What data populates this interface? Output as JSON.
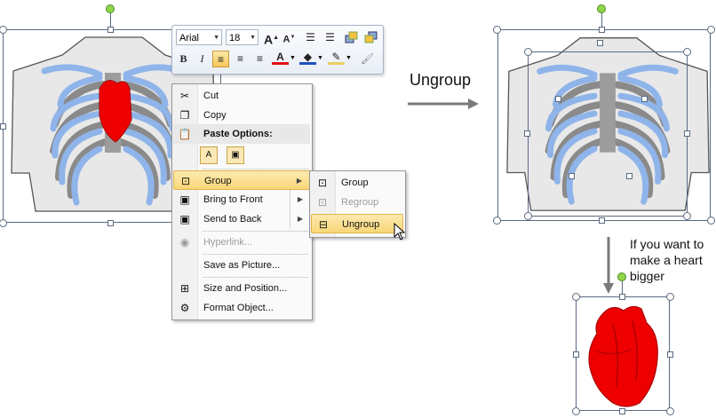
{
  "toolbar": {
    "font_name": "Arial",
    "font_size": "18",
    "buttons": [
      "grow-font",
      "shrink-font",
      "decrease-indent",
      "increase-indent",
      "bring-forward",
      "send-backward",
      "bold",
      "italic",
      "align-left",
      "center",
      "align-right",
      "font-color",
      "fill-color",
      "outline-color",
      "format-painter"
    ],
    "bold_label": "B",
    "italic_label": "I",
    "font_color_label": "A",
    "accent_highlight": "#f6c65c"
  },
  "context_menu": {
    "items": [
      {
        "label": "Cut",
        "icon": "scissors-icon",
        "enabled": true
      },
      {
        "label": "Copy",
        "icon": "copy-icon",
        "enabled": true
      },
      {
        "label": "Paste Options:",
        "icon": "clipboard-icon",
        "enabled": true,
        "header": true
      },
      {
        "label": "Group",
        "icon": "group-icon",
        "enabled": true,
        "submenu": true,
        "highlighted": true
      },
      {
        "label": "Bring to Front",
        "icon": "bring-front-icon",
        "enabled": true,
        "submenu": true
      },
      {
        "label": "Send to Back",
        "icon": "send-back-icon",
        "enabled": true,
        "submenu": true
      },
      {
        "label": "Hyperlink...",
        "icon": "globe-icon",
        "enabled": false
      },
      {
        "label": "Save as Picture...",
        "icon": "",
        "enabled": true
      },
      {
        "label": "Size and Position...",
        "icon": "size-position-icon",
        "enabled": true
      },
      {
        "label": "Format Object...",
        "icon": "format-object-icon",
        "enabled": true
      }
    ]
  },
  "submenu": {
    "items": [
      {
        "label": "Group",
        "enabled": true
      },
      {
        "label": "Regroup",
        "enabled": false
      },
      {
        "label": "Ungroup",
        "enabled": true,
        "highlighted": true
      }
    ]
  },
  "annotations": {
    "ungroup": "Ungroup",
    "note_line1": "If you want to",
    "note_line2": "make a heart",
    "note_line3": "bigger"
  },
  "colors": {
    "rib_blue": "#8fb4ea",
    "rib_grey": "#8a8a8a",
    "body_grey": "#e8e8e8",
    "heart_red": "#ee0000",
    "arrow_grey": "#7a7a7a"
  }
}
